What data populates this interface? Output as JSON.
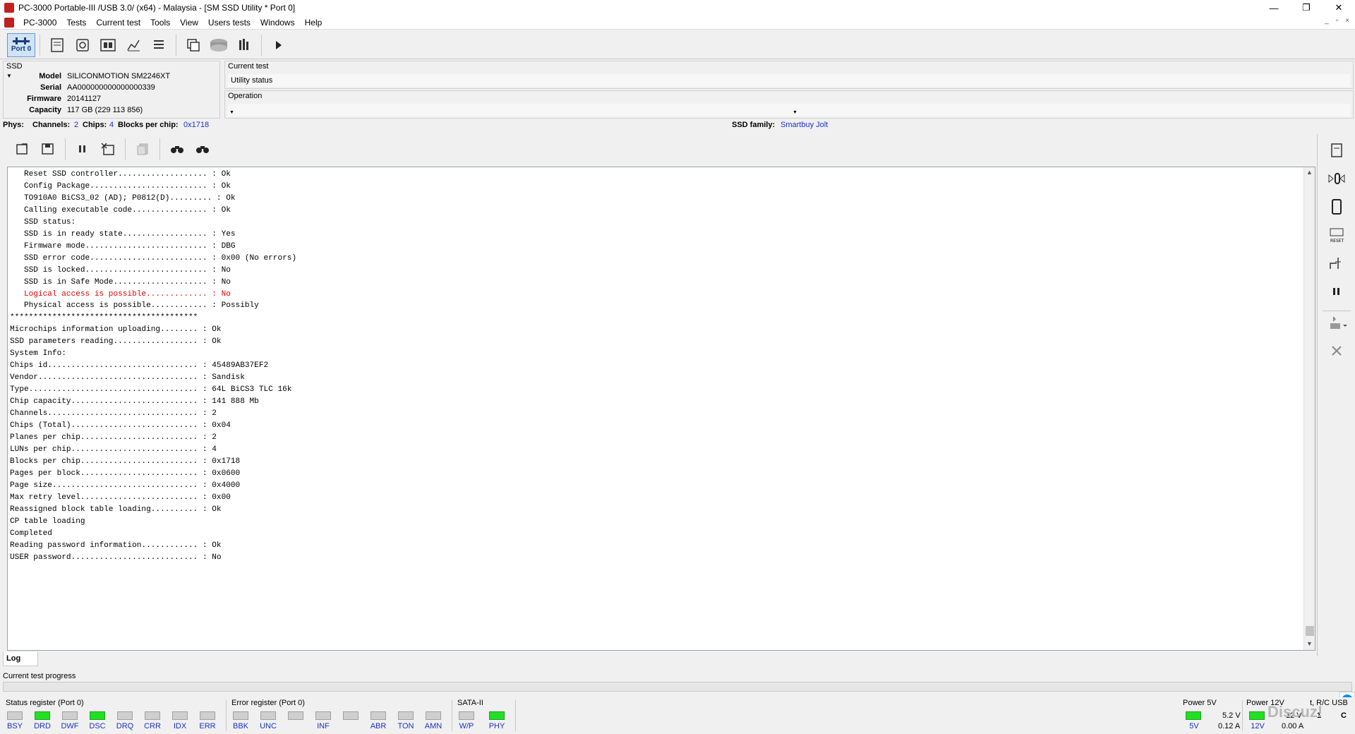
{
  "window": {
    "title": "PC-3000 Portable-III /USB 3.0/ (x64) - Malaysia - [SM SSD Utility * Port 0]",
    "controls": [
      "—",
      "❐",
      "✕"
    ]
  },
  "menu": [
    "PC-3000",
    "Tests",
    "Current test",
    "Tools",
    "View",
    "Users tests",
    "Windows",
    "Help"
  ],
  "mdi_controls": [
    "_",
    "▫",
    "×"
  ],
  "toolbar": {
    "port_label": "Port 0"
  },
  "ssd": {
    "group_label": "SSD",
    "model_label": "Model",
    "model": "SILICONMOTION SM2246XT",
    "serial_label": "Serial",
    "serial": "AA000000000000000339",
    "firmware_label": "Firmware",
    "firmware": "20141127",
    "capacity_label": "Capacity",
    "capacity": "117 GB (229 113 856)"
  },
  "current_test": {
    "label": "Current test",
    "value": "Utility status"
  },
  "operation": {
    "label": "Operation",
    "value": ""
  },
  "phys": {
    "label": "Phys:",
    "channels_label": "Channels:",
    "channels": "2",
    "chips_label": "Chips:",
    "chips": "4",
    "blocks_label": "Blocks per chip:",
    "blocks": "0x1718",
    "family_label": "SSD family:",
    "family": "Smartbuy Jolt"
  },
  "log": {
    "lines": [
      {
        "text": "   Reset SSD controller................... : Ok",
        "red": false
      },
      {
        "text": "   Config Package......................... : Ok",
        "red": false
      },
      {
        "text": "   TO910A0 BiCS3_02 (AD); P0812(D)......... : Ok",
        "red": false
      },
      {
        "text": "   Calling executable code................ : Ok",
        "red": false
      },
      {
        "text": "",
        "red": false
      },
      {
        "text": "   SSD status:",
        "red": false
      },
      {
        "text": "   SSD is in ready state.................. : Yes",
        "red": false
      },
      {
        "text": "   Firmware mode.......................... : DBG",
        "red": false
      },
      {
        "text": "   SSD error code......................... : 0x00 (No errors)",
        "red": false
      },
      {
        "text": "   SSD is locked.......................... : No",
        "red": false
      },
      {
        "text": "   SSD is in Safe Mode.................... : No",
        "red": false
      },
      {
        "text": "   Logical access is possible............. : No",
        "red": true
      },
      {
        "text": "   Physical access is possible............ : Possibly",
        "red": false
      },
      {
        "text": "****************************************",
        "red": false
      },
      {
        "text": "",
        "red": false
      },
      {
        "text": "Microchips information uploading........ : Ok",
        "red": false
      },
      {
        "text": "SSD parameters reading.................. : Ok",
        "red": false
      },
      {
        "text": "",
        "red": false
      },
      {
        "text": "System Info:",
        "red": false
      },
      {
        "text": "Chips id................................ : 45489AB37EF2",
        "red": false
      },
      {
        "text": "Vendor.................................. : Sandisk",
        "red": false
      },
      {
        "text": "Type.................................... : 64L BiCS3 TLC 16k",
        "red": false
      },
      {
        "text": "Chip capacity........................... : 141 888 Mb",
        "red": false
      },
      {
        "text": "Channels................................ : 2",
        "red": false
      },
      {
        "text": "Chips (Total)........................... : 0x04",
        "red": false
      },
      {
        "text": "Planes per chip......................... : 2",
        "red": false
      },
      {
        "text": "LUNs per chip........................... : 4",
        "red": false
      },
      {
        "text": "Blocks per chip......................... : 0x1718",
        "red": false
      },
      {
        "text": "Pages per block......................... : 0x0600",
        "red": false
      },
      {
        "text": "Page size............................... : 0x4000",
        "red": false
      },
      {
        "text": "Max retry level......................... : 0x00",
        "red": false
      },
      {
        "text": "",
        "red": false
      },
      {
        "text": "Reassigned block table loading.......... : Ok",
        "red": false
      },
      {
        "text": "",
        "red": false
      },
      {
        "text": "CP table loading",
        "red": false
      },
      {
        "text": "Completed",
        "red": false
      },
      {
        "text": "",
        "red": false
      },
      {
        "text": "Reading password information............ : Ok",
        "red": false
      },
      {
        "text": "USER password........................... : No",
        "red": false
      }
    ]
  },
  "log_tab": "Log",
  "progress": {
    "label": "Current test progress",
    "fraction": 0
  },
  "status_register": {
    "label": "Status register (Port 0)",
    "leds": [
      {
        "name": "BSY",
        "on": false
      },
      {
        "name": "DRD",
        "on": true
      },
      {
        "name": "DWF",
        "on": false
      },
      {
        "name": "DSC",
        "on": true
      },
      {
        "name": "DRQ",
        "on": false
      },
      {
        "name": "CRR",
        "on": false
      },
      {
        "name": "IDX",
        "on": false
      },
      {
        "name": "ERR",
        "on": false
      }
    ]
  },
  "error_register": {
    "label": "Error register (Port 0)",
    "leds": [
      {
        "name": "BBK",
        "on": false
      },
      {
        "name": "UNC",
        "on": false
      },
      {
        "name": "",
        "on": false
      },
      {
        "name": "INF",
        "on": false
      },
      {
        "name": "",
        "on": false
      },
      {
        "name": "ABR",
        "on": false
      },
      {
        "name": "TON",
        "on": false
      },
      {
        "name": "AMN",
        "on": false
      }
    ]
  },
  "sata": {
    "label": "SATA-II",
    "leds": [
      {
        "name": "W/P",
        "on": false
      },
      {
        "name": "PHY",
        "on": true
      }
    ]
  },
  "power5": {
    "label": "Power 5V",
    "led": "5V",
    "voltage": "5.2 V",
    "current": "0.12 A"
  },
  "power12": {
    "label": "Power 12V",
    "led": "12V",
    "voltage": "12 V",
    "current": "0.00 A"
  },
  "rc": {
    "label": "t, R/C USB",
    "c1": "1",
    "c2": "C"
  },
  "watermark": "Discuz!"
}
